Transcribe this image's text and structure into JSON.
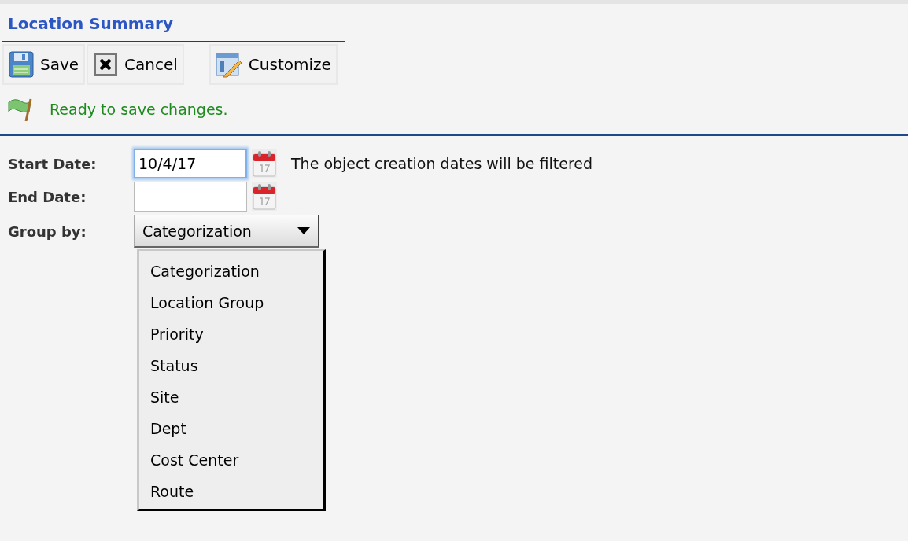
{
  "header": {
    "title": "Location Summary"
  },
  "toolbar": [
    {
      "kind": "save",
      "label": "Save"
    },
    {
      "kind": "cancel",
      "label": "Cancel"
    },
    {
      "kind": "customize",
      "label": "Customize"
    }
  ],
  "status_message": "Ready to save changes.",
  "form": {
    "start_date": {
      "label": "Start Date:",
      "value": "10/4/17",
      "focused": true,
      "note": "The object creation dates will be filtered"
    },
    "end_date": {
      "label": "End Date:",
      "focused": false
    },
    "group_by": {
      "label": "Group by:",
      "value": "Categorization",
      "expanded": true,
      "options": [
        "Categorization",
        "Location Group",
        "Priority",
        "Status",
        "Site",
        "Dept",
        "Cost Center",
        "Route"
      ]
    }
  }
}
